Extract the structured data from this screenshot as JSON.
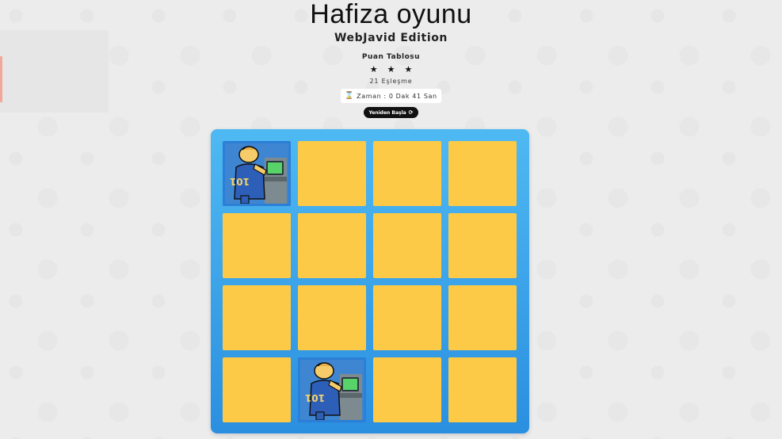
{
  "header": {
    "title": "Hafiza oyunu",
    "subtitle": "WebJavid Edition",
    "score_title": "Puan Tablosu",
    "stars": [
      "★",
      "★",
      "★"
    ],
    "moves": "21 Eşleşme",
    "timer_icon": "hourglass-icon",
    "timer": "Zaman : 0 Dak 41 San",
    "restart_label": "Yeniden Başla",
    "restart_icon": "refresh-icon"
  },
  "colors": {
    "card_closed": "#fdca48",
    "deck": "#2a8fe0",
    "card_open": "#2b7fd6"
  },
  "deck": {
    "rows": 4,
    "cols": 4,
    "cards": [
      {
        "state": "open",
        "icon": "vault-boy-computer-icon"
      },
      {
        "state": "closed"
      },
      {
        "state": "closed"
      },
      {
        "state": "closed"
      },
      {
        "state": "closed"
      },
      {
        "state": "closed"
      },
      {
        "state": "closed"
      },
      {
        "state": "closed"
      },
      {
        "state": "closed"
      },
      {
        "state": "closed"
      },
      {
        "state": "closed"
      },
      {
        "state": "closed"
      },
      {
        "state": "closed"
      },
      {
        "state": "open",
        "icon": "vault-boy-computer-icon"
      },
      {
        "state": "closed"
      },
      {
        "state": "closed"
      }
    ]
  }
}
